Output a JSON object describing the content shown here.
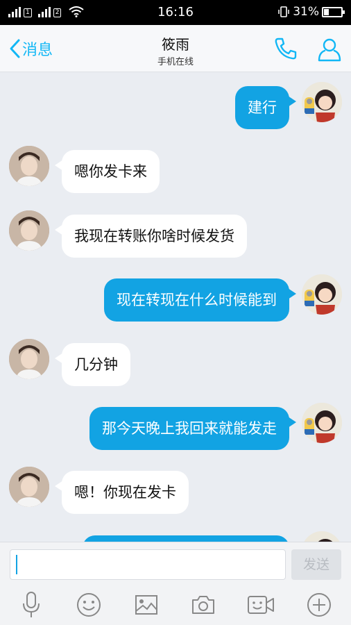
{
  "status_bar": {
    "sim1": "1",
    "sim2": "2",
    "time": "16:16",
    "battery": "31%",
    "battery_level": 0.31
  },
  "header": {
    "back_label": "消息",
    "title": "筱雨",
    "subtitle": "手机在线"
  },
  "messages": [
    {
      "side": "out",
      "text": "建行"
    },
    {
      "side": "in",
      "text": "嗯你发卡来"
    },
    {
      "side": "in",
      "text": "我现在转账你啥时候发货"
    },
    {
      "side": "out",
      "text": "现在转现在什么时候能到"
    },
    {
      "side": "in",
      "text": "几分钟"
    },
    {
      "side": "out",
      "text": "那今天晚上我回来就能发走"
    },
    {
      "side": "in",
      "text": "嗯！你现在发卡"
    },
    {
      "side": "out",
      "text": ""
    }
  ],
  "input": {
    "value": "",
    "send_label": "发送"
  },
  "toolbar": [
    "mic-icon",
    "emoji-icon",
    "image-icon",
    "camera-icon",
    "video-icon",
    "plus-icon"
  ],
  "colors": {
    "accent": "#12b7f5",
    "out_bubble": "#12a3e3",
    "background": "#eaedf2"
  }
}
